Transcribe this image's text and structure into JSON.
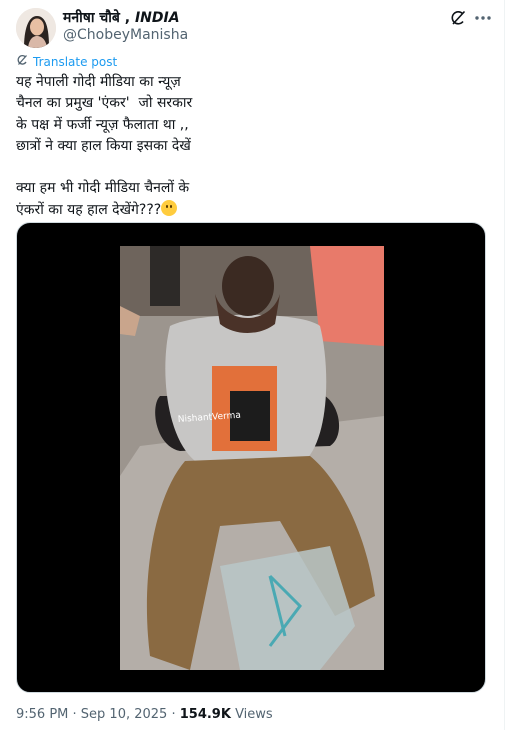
{
  "author": {
    "name_prefix": "मनीषा चौबे , ",
    "name_country": "INDIA",
    "handle": "@ChobeyManisha"
  },
  "icons": {
    "grok": "grok-icon",
    "more": "more-icon",
    "translate": "translate-icon",
    "emoji": "slightly-smiling-face"
  },
  "translate_label": "Translate post",
  "tweet_text": "यह नेपाली गोदी मीडिया का न्यूज़\nचैनल का प्रमुख 'एंकर'  जो सरकार\nके पक्ष में फर्जी न्यूज़ फैलाता था ,,\nछात्रों ने क्या हाल किया इसका देखें\n\nक्या हम भी गोदी मीडिया चैनलों के\nएंकरों का यह हाल देखेंगे???",
  "media": {
    "watermark": "NishantVerma"
  },
  "meta": {
    "time": "9:56 PM",
    "separator": " · ",
    "date": "Sep 10, 2025",
    "views_count": "154.9K",
    "views_label": " Views"
  },
  "colors": {
    "link_blue": "#1d9bf0",
    "secondary": "#536471",
    "text": "#0f1419"
  }
}
